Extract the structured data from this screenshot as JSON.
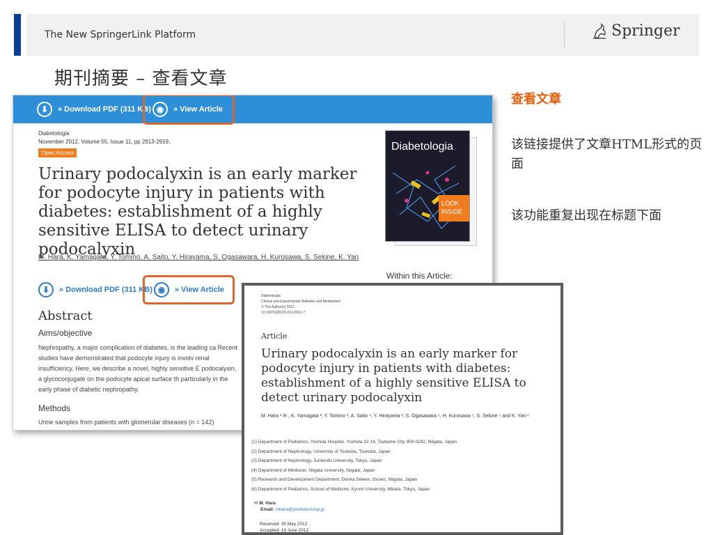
{
  "header": {
    "title": "The New SpringerLink Platform",
    "logo_text": "Springer",
    "logo_icon": "springer-horse-icon"
  },
  "slide_title": "期刊摘要 – 查看文章",
  "notes": {
    "heading": "查看文章",
    "line1": "该链接提供了文章HTML形式的页面",
    "line2": "该功能重复出现在标题下面"
  },
  "article_page": {
    "download_label": "» Download PDF (311 KB)",
    "view_label": "» View Article",
    "journal": "Diabetologia",
    "meta": "November 2012, Volume 55, Issue 11, pp 2913-2919,",
    "open_access": "Open Access",
    "title": "Urinary podocalyxin is an early marker for podocyte injury in patients with diabetes: establishment of a highly sensitive ELISA to detect urinary podocalyxin",
    "authors": "M. Hara, K. Yamagata, Y. Tomino, A. Saito, Y. Hirayama, S. Ogasawara, H. Kurosawa, S. Sekine, K. Yan",
    "abstract_heading": "Abstract",
    "aims_heading": "Aims/objective",
    "aims_text": "Nephropathy, a major complication of diabetes, is the leading ca Recent studies have demonstrated that podocyte injury is involv renal insufficiency. Here, we describe a novel, highly sensitive E podocalyxin, a glycoconjugate on the podocyte apical surface th particularly in the early phase of diabetic nephropathy.",
    "methods_heading": "Methods",
    "methods_text": "Urine samples from patients with glomerular diseases (n = 142)",
    "cover_title": "Diabetologia",
    "cover_look": "LOOK INSIDE",
    "within": "Within this Article:"
  },
  "html_view": {
    "journal": "Diabetologia",
    "subtitle": "Clinical and Experimental Diabetes and Metabolism",
    "copyright": "© The Author(s) 2012",
    "doi": "10.1007/s00125-012-2661-7",
    "article_label": "Article",
    "title": "Urinary podocalyxin is an early marker for podocyte injury in patients with diabetes: establishment of a highly sensitive ELISA to detect urinary podocalyxin",
    "authors": "M. Hara ¹ ✉ , K. Yamagata ², Y. Tomino ³, A. Saito ⁴, Y. Hirayama ², S. Ogasawara ⁵, H. Kurosawa ⁵, S. Sekine ⁵ and K. Yan ⁶",
    "affiliations": [
      "(1) Department of Pediatrics, Yoshida Hospital, Yoshida 32-14, Tsubame City 959-0242, Niigata, Japan",
      "(2) Department of Nephrology, University of Tsukuba, Tsukuba, Japan",
      "(3) Department of Nephrology, Juntendo University, Tokyo, Japan",
      "(4) Department of Medicine, Niigata University, Niigata, Japan",
      "(5) Research and Development Department, Denka Seiken, Gosen, Niigata, Japan",
      "(6) Department of Pediatrics, School of Medicine, Kyorin University, Mitaka, Tokyo, Japan"
    ],
    "contact_name": "M. Hara",
    "email_label": "Email:",
    "email": "mhara@yoshida-hosp.jp",
    "received": "Received: 30 May 2012",
    "accepted": "Accepted: 19 June 2012"
  },
  "colors": {
    "brand_blue": "#0b3d91",
    "bar_blue": "#2d8fd8",
    "highlight_orange": "#d9662a",
    "note_orange": "#e06010"
  }
}
